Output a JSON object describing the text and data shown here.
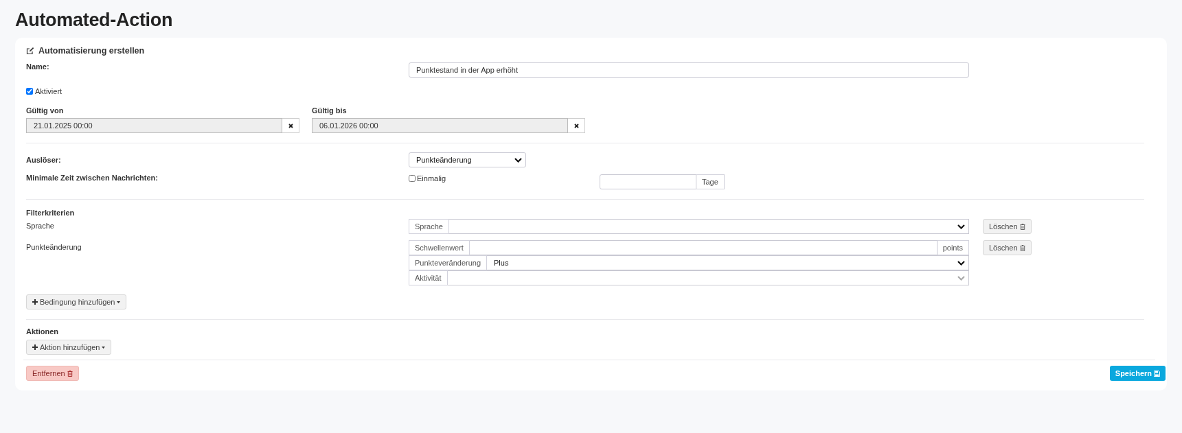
{
  "title": "Automated-Action",
  "form": {
    "header": "Automatisierung erstellen",
    "name": {
      "label": "Name:",
      "value": "Punktestand in der App erhöht"
    },
    "activated": {
      "label": "Aktiviert",
      "checked": true
    },
    "valid_from": {
      "label": "Gültig von",
      "value": "21.01.2025 00:00"
    },
    "valid_to": {
      "label": "Gültig bis",
      "value": "06.01.2026 00:00"
    },
    "trigger": {
      "label": "Auslöser:",
      "value": "Punkteänderung"
    },
    "min_time": {
      "label": "Minimale Zeit zwischen Nachrichten:",
      "once": {
        "label": "Einmalig",
        "checked": false
      },
      "unit": "Tage"
    },
    "filters": {
      "heading": "Filterkriterien",
      "groups": [
        {
          "label": "Sprache",
          "delete_button": "Löschen",
          "rows": [
            {
              "kind": "select",
              "addon": "Sprache",
              "disabled": false
            }
          ]
        },
        {
          "label": "Punkteänderung",
          "delete_button": "Löschen",
          "rows": [
            {
              "kind": "number",
              "addon": "Schwellenwert",
              "suffix": "points"
            },
            {
              "kind": "select",
              "addon": "Punkteveränderung",
              "value": "Plus",
              "disabled": false
            },
            {
              "kind": "select",
              "addon": "Aktivität",
              "disabled": true
            }
          ]
        }
      ]
    },
    "add_condition_button": "Bedingung hinzufügen",
    "actions": {
      "heading": "Aktionen",
      "add_button": "Aktion hinzufügen"
    },
    "remove_button": "Entfernen",
    "save_button": "Speichern"
  }
}
